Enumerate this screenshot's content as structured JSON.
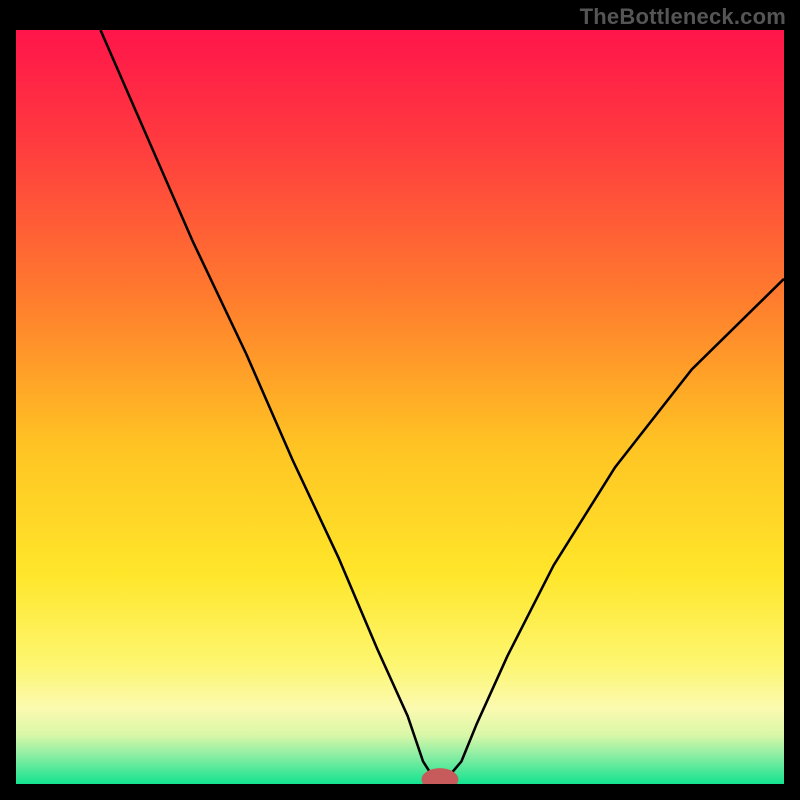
{
  "watermark": "TheBottleneck.com",
  "chart_data": {
    "type": "line",
    "title": "",
    "xlabel": "",
    "ylabel": "",
    "xlim": [
      0,
      100
    ],
    "ylim": [
      0,
      100
    ],
    "background_gradient": {
      "stops": [
        {
          "offset": 0.0,
          "color": "#ff154a"
        },
        {
          "offset": 0.15,
          "color": "#ff3b3f"
        },
        {
          "offset": 0.35,
          "color": "#ff7a2e"
        },
        {
          "offset": 0.55,
          "color": "#ffc323"
        },
        {
          "offset": 0.72,
          "color": "#ffe62a"
        },
        {
          "offset": 0.84,
          "color": "#fdf66f"
        },
        {
          "offset": 0.9,
          "color": "#fbfab0"
        },
        {
          "offset": 0.935,
          "color": "#d9f7a8"
        },
        {
          "offset": 0.965,
          "color": "#82eda2"
        },
        {
          "offset": 1.0,
          "color": "#13e38f"
        }
      ]
    },
    "series": [
      {
        "name": "bottleneck-curve",
        "color": "#000000",
        "stroke_width": 2.5,
        "x": [
          11,
          17,
          23,
          30,
          36,
          42,
          47,
          51,
          53,
          54.5,
          56,
          58,
          60,
          64,
          70,
          78,
          88,
          100
        ],
        "y": [
          100,
          86,
          72,
          57,
          43,
          30,
          18,
          9,
          3,
          0.6,
          0.6,
          3,
          8,
          17,
          29,
          42,
          55,
          67
        ]
      }
    ],
    "marker": {
      "name": "optimal-point",
      "x": 55.2,
      "y": 0.6,
      "rx": 2.4,
      "ry": 1.5,
      "fill": "#c75a5a"
    }
  }
}
